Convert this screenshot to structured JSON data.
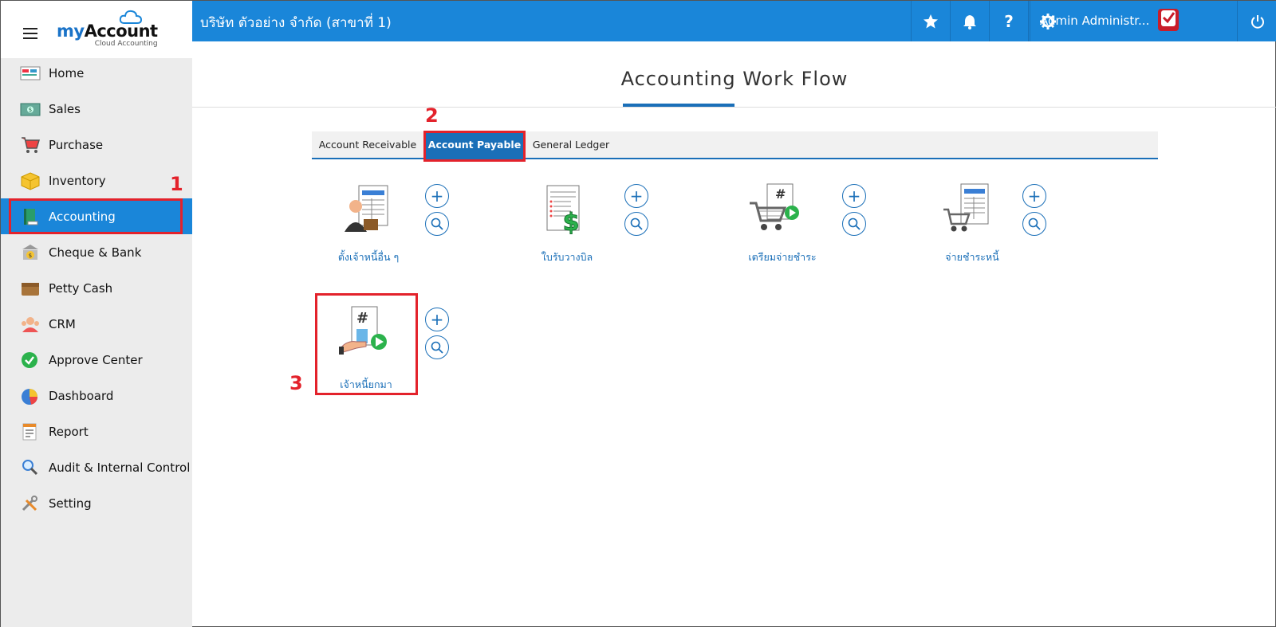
{
  "company": "บริษัท ตัวอย่าง จำกัด (สาขาที่ 1)",
  "logo": {
    "brand_my": "my",
    "brand_rest": "Account",
    "sub": "Cloud Accounting"
  },
  "user": {
    "name": "Admin Administr..."
  },
  "sidebar": {
    "items": [
      {
        "label": "Home",
        "icon": "home-icon"
      },
      {
        "label": "Sales",
        "icon": "sales-icon"
      },
      {
        "label": "Purchase",
        "icon": "cart-icon"
      },
      {
        "label": "Inventory",
        "icon": "box-icon"
      },
      {
        "label": "Accounting",
        "icon": "book-icon",
        "active": true
      },
      {
        "label": "Cheque & Bank",
        "icon": "bank-icon"
      },
      {
        "label": "Petty Cash",
        "icon": "wallet-icon"
      },
      {
        "label": "CRM",
        "icon": "people-icon"
      },
      {
        "label": "Approve Center",
        "icon": "check-circle-icon"
      },
      {
        "label": "Dashboard",
        "icon": "pie-chart-icon"
      },
      {
        "label": "Report",
        "icon": "report-icon"
      },
      {
        "label": "Audit & Internal Control",
        "icon": "magnifier-icon"
      },
      {
        "label": "Setting",
        "icon": "tools-icon"
      }
    ]
  },
  "main": {
    "title": "Accounting Work Flow",
    "tabs": [
      {
        "label": "Account Receivable"
      },
      {
        "label": "Account Payable",
        "active": true
      },
      {
        "label": "General Ledger"
      }
    ],
    "workflow": [
      {
        "label": "ตั้งเจ้าหนี้อื่น ๆ"
      },
      {
        "label": "ใบรับวางบิล"
      },
      {
        "label": "เตรียมจ่ายชำระ"
      },
      {
        "label": "จ่ายชำระหนี้"
      },
      {
        "label": "เจ้าหนี้ยกมา"
      }
    ]
  },
  "annotations": {
    "step1": "1",
    "step2": "2",
    "step3": "3"
  },
  "colors": {
    "primary": "#1a86d9",
    "tab_active": "#1a6fb8",
    "highlight": "#e3222b"
  }
}
